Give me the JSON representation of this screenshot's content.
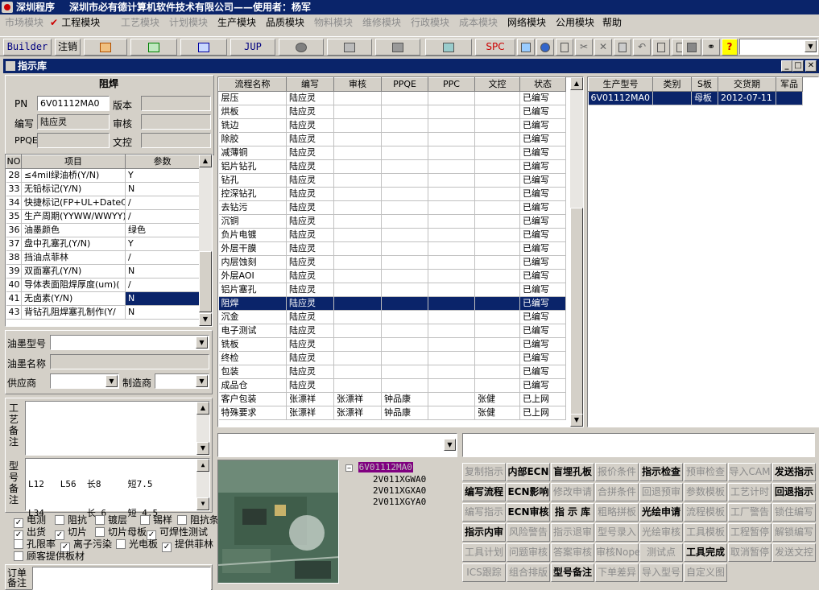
{
  "app": {
    "title": "深圳程序",
    "company": "深圳市必有德计算机软件技术有限公司——使用者：杨军"
  },
  "menu": [
    {
      "label": "市场模块",
      "enabled": false
    },
    {
      "label": "工程模块",
      "enabled": true,
      "checked": true
    },
    {
      "label": "工艺模块",
      "enabled": false
    },
    {
      "label": "计划模块",
      "enabled": false
    },
    {
      "label": "生产模块",
      "enabled": true
    },
    {
      "label": "品质模块",
      "enabled": true
    },
    {
      "label": "物料模块",
      "enabled": false
    },
    {
      "label": "维修模块",
      "enabled": false
    },
    {
      "label": "行政模块",
      "enabled": false
    },
    {
      "label": "成本模块",
      "enabled": false
    },
    {
      "label": "网络模块",
      "enabled": true
    },
    {
      "label": "公用模块",
      "enabled": true
    },
    {
      "label": "帮助",
      "enabled": true
    }
  ],
  "toolbar": {
    "builder": "Builder",
    "logout": "注销",
    "jup": "JUP",
    "spc": "SPC"
  },
  "window": {
    "title": "指示库"
  },
  "left": {
    "header": "阻焊",
    "pn_label": "PN",
    "pn_value": "6V01112MA0",
    "version_label": "版本",
    "version_value": "",
    "editor_label": "编写",
    "editor_value": "陆应灵",
    "review_label": "审核",
    "review_value": "",
    "ppqe_label": "PPQE",
    "ppqe_value": "",
    "doc_label": "文控",
    "doc_value": "",
    "param_cols": [
      "NO",
      "项目",
      "参数"
    ],
    "params": [
      {
        "no": "28",
        "item": "≤4mil绿油桥(Y/N)",
        "val": "Y"
      },
      {
        "no": "33",
        "item": "无铅标记(Y/N)",
        "val": "N"
      },
      {
        "no": "34",
        "item": "快捷标记(FP+UL+DateCo",
        "val": "/"
      },
      {
        "no": "35",
        "item": "生产周期(YYWW/WWYY)",
        "val": "/"
      },
      {
        "no": "36",
        "item": "油墨颜色",
        "val": "绿色"
      },
      {
        "no": "37",
        "item": "盘中孔塞孔(Y/N)",
        "val": "Y"
      },
      {
        "no": "38",
        "item": "挡油点菲林",
        "val": "/"
      },
      {
        "no": "39",
        "item": "双面塞孔(Y/N)",
        "val": "N"
      },
      {
        "no": "40",
        "item": "导体表面阻焊厚度(um)(",
        "val": "/"
      },
      {
        "no": "41",
        "item": "无卤素(Y/N)",
        "val": "N"
      },
      {
        "no": "43",
        "item": "背钻孔阻焊塞孔制作(Y/",
        "val": "N"
      }
    ],
    "ink_model_label": "油墨型号",
    "ink_name_label": "油墨名称",
    "supplier_label": "供应商",
    "maker_label": "制造商",
    "craft_note_label": "工艺备注",
    "type_note_label": "型号备注",
    "type_note_lines": [
      "L12   L56  长8     短7.5",
      "L34        长 6    短 4.5"
    ],
    "checks": [
      [
        {
          "label": "电测",
          "checked": true
        },
        {
          "label": "阻抗",
          "checked": false
        },
        {
          "label": "镀层",
          "checked": false
        },
        {
          "label": "锡样",
          "checked": false
        },
        {
          "label": "阻抗条",
          "checked": false
        }
      ],
      [
        {
          "label": "出货",
          "checked": true
        },
        {
          "label": "切片",
          "checked": true
        },
        {
          "label": "切片母板",
          "checked": false
        },
        {
          "label": "可焊性测试",
          "checked": true
        }
      ],
      [
        {
          "label": "孔限率",
          "checked": false
        },
        {
          "label": "离子污染",
          "checked": true
        },
        {
          "label": "光电板",
          "checked": false
        },
        {
          "label": "提供菲林",
          "checked": true
        }
      ],
      [
        {
          "label": "顾客提供板材",
          "checked": false
        }
      ]
    ],
    "order_note_label": "订单备注"
  },
  "process": {
    "cols": [
      "流程名称",
      "编写",
      "审核",
      "PPQE",
      "PPC",
      "文控",
      "状态"
    ],
    "rows": [
      [
        "层压",
        "陆应灵",
        "",
        "",
        "",
        "",
        "已编写"
      ],
      [
        "烘板",
        "陆应灵",
        "",
        "",
        "",
        "",
        "已编写"
      ],
      [
        "铣边",
        "陆应灵",
        "",
        "",
        "",
        "",
        "已编写"
      ],
      [
        "除胶",
        "陆应灵",
        "",
        "",
        "",
        "",
        "已编写"
      ],
      [
        "减薄铜",
        "陆应灵",
        "",
        "",
        "",
        "",
        "已编写"
      ],
      [
        "铝片钻孔",
        "陆应灵",
        "",
        "",
        "",
        "",
        "已编写"
      ],
      [
        "钻孔",
        "陆应灵",
        "",
        "",
        "",
        "",
        "已编写"
      ],
      [
        "控深钻孔",
        "陆应灵",
        "",
        "",
        "",
        "",
        "已编写"
      ],
      [
        "去钻污",
        "陆应灵",
        "",
        "",
        "",
        "",
        "已编写"
      ],
      [
        "沉铜",
        "陆应灵",
        "",
        "",
        "",
        "",
        "已编写"
      ],
      [
        "负片电镀",
        "陆应灵",
        "",
        "",
        "",
        "",
        "已编写"
      ],
      [
        "外层干膜",
        "陆应灵",
        "",
        "",
        "",
        "",
        "已编写"
      ],
      [
        "内层蚀刻",
        "陆应灵",
        "",
        "",
        "",
        "",
        "已编写"
      ],
      [
        "外层AOI",
        "陆应灵",
        "",
        "",
        "",
        "",
        "已编写"
      ],
      [
        "铝片塞孔",
        "陆应灵",
        "",
        "",
        "",
        "",
        "已编写"
      ],
      [
        "阻焊",
        "陆应灵",
        "",
        "",
        "",
        "",
        "已编写"
      ],
      [
        "沉金",
        "陆应灵",
        "",
        "",
        "",
        "",
        "已编写"
      ],
      [
        "电子测试",
        "陆应灵",
        "",
        "",
        "",
        "",
        "已编写"
      ],
      [
        "铣板",
        "陆应灵",
        "",
        "",
        "",
        "",
        "已编写"
      ],
      [
        "终检",
        "陆应灵",
        "",
        "",
        "",
        "",
        "已编写"
      ],
      [
        "包装",
        "陆应灵",
        "",
        "",
        "",
        "",
        "已编写"
      ],
      [
        "成品仓",
        "陆应灵",
        "",
        "",
        "",
        "",
        "已编写"
      ],
      [
        "客户包装",
        "张漂祥",
        "张漂祥",
        "钟品康",
        "",
        "张健",
        "已上网"
      ],
      [
        "特殊要求",
        "张漂祥",
        "张漂祥",
        "钟品康",
        "",
        "张健",
        "已上网"
      ]
    ],
    "selected": 15
  },
  "orders": {
    "cols": [
      "生产型号",
      "类别",
      "S板",
      "交货期",
      "军品"
    ],
    "rows": [
      [
        "6V01112MA0",
        "",
        "母板",
        "2012-07-11",
        ""
      ]
    ]
  },
  "tree": {
    "root": "6V01112MA0",
    "children": [
      "2V011XGWA0",
      "2V011XGXA0",
      "2V011XGYA0"
    ]
  },
  "actions": [
    [
      {
        "label": "复制指示",
        "enabled": false
      },
      {
        "label": "内部ECN",
        "enabled": true
      },
      {
        "label": "盲埋孔板",
        "enabled": true
      },
      {
        "label": "报价条件",
        "enabled": false
      },
      {
        "label": "指示检查",
        "enabled": true
      },
      {
        "label": "预审检查",
        "enabled": false
      },
      {
        "label": "导入CAM",
        "enabled": false
      },
      {
        "label": "发送指示",
        "enabled": true
      }
    ],
    [
      {
        "label": "编写流程",
        "enabled": true
      },
      {
        "label": "ECN影响",
        "enabled": true
      },
      {
        "label": "修改申请",
        "enabled": false
      },
      {
        "label": "合拼条件",
        "enabled": false
      },
      {
        "label": "回退预审",
        "enabled": false
      },
      {
        "label": "参数模板",
        "enabled": false
      },
      {
        "label": "工艺计时",
        "enabled": false
      },
      {
        "label": "回退指示",
        "enabled": true
      }
    ],
    [
      {
        "label": "编写指示",
        "enabled": false
      },
      {
        "label": "ECN审核",
        "enabled": true
      },
      {
        "label": "指 示 库",
        "enabled": true
      },
      {
        "label": "粗略拼板",
        "enabled": false
      },
      {
        "label": "光绘申请",
        "enabled": true
      },
      {
        "label": "流程模板",
        "enabled": false
      },
      {
        "label": "工厂警告",
        "enabled": false
      },
      {
        "label": "锁住编写",
        "enabled": false
      }
    ],
    [
      {
        "label": "指示内审",
        "enabled": true
      },
      {
        "label": "风险警告",
        "enabled": false
      },
      {
        "label": "指示退审",
        "enabled": false
      },
      {
        "label": "型号录入",
        "enabled": false
      },
      {
        "label": "光绘审核",
        "enabled": false
      },
      {
        "label": "工具模板",
        "enabled": false
      },
      {
        "label": "工程暂停",
        "enabled": false
      },
      {
        "label": "解锁编写",
        "enabled": false
      }
    ],
    [
      {
        "label": "工具计划",
        "enabled": false
      },
      {
        "label": "问题审核",
        "enabled": false
      },
      {
        "label": "答案审核",
        "enabled": false
      },
      {
        "label": "审核Nope",
        "enabled": false
      },
      {
        "label": "测试点",
        "enabled": false
      },
      {
        "label": "工具完成",
        "enabled": true
      },
      {
        "label": "取消暂停",
        "enabled": false
      },
      {
        "label": "发送文控",
        "enabled": false
      }
    ],
    [
      {
        "label": "ICS跟踪",
        "enabled": false
      },
      {
        "label": "组合排版",
        "enabled": false
      },
      {
        "label": "型号备注",
        "enabled": true
      },
      {
        "label": "下单差异",
        "enabled": false
      },
      {
        "label": "导入型号",
        "enabled": false
      },
      {
        "label": "自定义图",
        "enabled": false
      }
    ]
  ],
  "colors": {
    "title_bg": "#0a246a",
    "face": "#d4d0c8",
    "disabled": "#8c8c8c",
    "tree_highlight": "#800080"
  }
}
